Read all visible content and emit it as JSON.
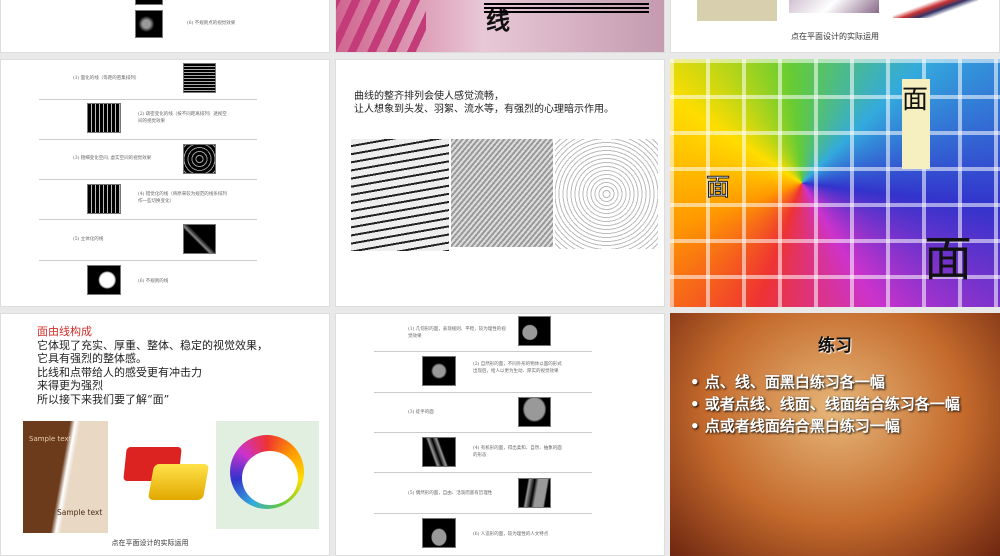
{
  "slides": {
    "top_left": {
      "caption": "(6) 不规则点的视觉效果"
    },
    "top_middle": {
      "title_glyph": "线"
    },
    "top_right": {
      "caption": "点在平面设计的实际运用"
    },
    "lines_list": {
      "items": [
        "(1) 面化的线（等距的密集排列）",
        "(2) 疏密变化的线（按不同距离排列）透视空间的视觉效果",
        "(3) 粗细变化空间, 虚实空间的视觉效果",
        "(4) 错觉化的线（将原来较为规范的线条排列作一些切换变化）",
        "(5) 立体化的线",
        "(6) 不规则的线"
      ]
    },
    "curve_slide": {
      "text_lines": [
        "曲线的整齐排列会使人感觉流畅，",
        "让人想象到头发、羽絮、流水等，有强烈的心理暗示作用。"
      ]
    },
    "color_slide": {
      "glyphs": [
        "面",
        "面",
        "面"
      ]
    },
    "face_slide": {
      "heading": "面由线构成",
      "lines": [
        "它体现了充实、厚重、整体、稳定的视觉效果，",
        "它具有强烈的整体感。",
        "比线和点带给人的感受更有冲击力",
        "来得更为强烈",
        "所以接下来我们要了解“面”"
      ],
      "sample_text_1": "Sample text",
      "sample_text_2": "Sample text",
      "caption": "点在平面设计的实际运用",
      "accent": "#d0302c"
    },
    "faces_list": {
      "items": [
        "(1) 几何形的面，表现规则、平稳，较为理性的视觉效果",
        "(2) 自然形的面，不同外形的物体以面的形式出现后，给人以更为生动、厚实的视觉效果",
        "(3) 徒手的面",
        "(4) 有机形的面，得出柔和、自然、抽象的面的形态",
        "(5) 偶然形的面，自由、活泼而富有哲理性",
        "(6) 人造形的面，较为理性的人文特点"
      ]
    },
    "exercise": {
      "title": "练习",
      "bullets": [
        "点、线、面黑白练习各一幅",
        "或者点线、线面、线面结合练习各一幅",
        "点或者线面结合黑白练习一幅"
      ]
    }
  }
}
